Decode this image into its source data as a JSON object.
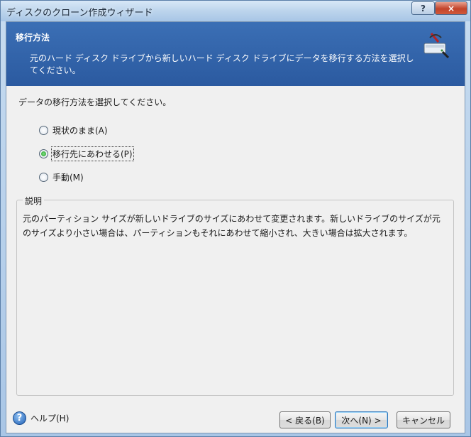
{
  "window": {
    "title": "ディスクのクローン作成ウィザード",
    "help_control": "?",
    "close_control": "×"
  },
  "header": {
    "title": "移行方法",
    "description": "元のハード ディスク ドライブから新しいハード ディスク ドライブにデータを移行する方法を選択してください。"
  },
  "body": {
    "prompt": "データの移行方法を選択してください。",
    "options": [
      {
        "label": "現状のまま(A)",
        "checked": false
      },
      {
        "label": "移行先にあわせる(P)",
        "checked": true
      },
      {
        "label": "手動(M)",
        "checked": false
      }
    ],
    "description_group": {
      "legend": "説明",
      "text": "元のパーティション サイズが新しいドライブのサイズにあわせて変更されます。新しいドライブのサイズが元のサイズより小さい場合は、パーティションもそれにあわせて縮小され、大きい場合は拡大されます。"
    }
  },
  "footer": {
    "help_label": "ヘルプ(H)",
    "back_label": "< 戻る(B)",
    "next_label": "次へ(N) >",
    "cancel_label": "キャンセル"
  },
  "colors": {
    "header_bg": "#2f62a8",
    "dialog_bg": "#f0f0f0",
    "radio_checked": "#1f9a2a"
  }
}
